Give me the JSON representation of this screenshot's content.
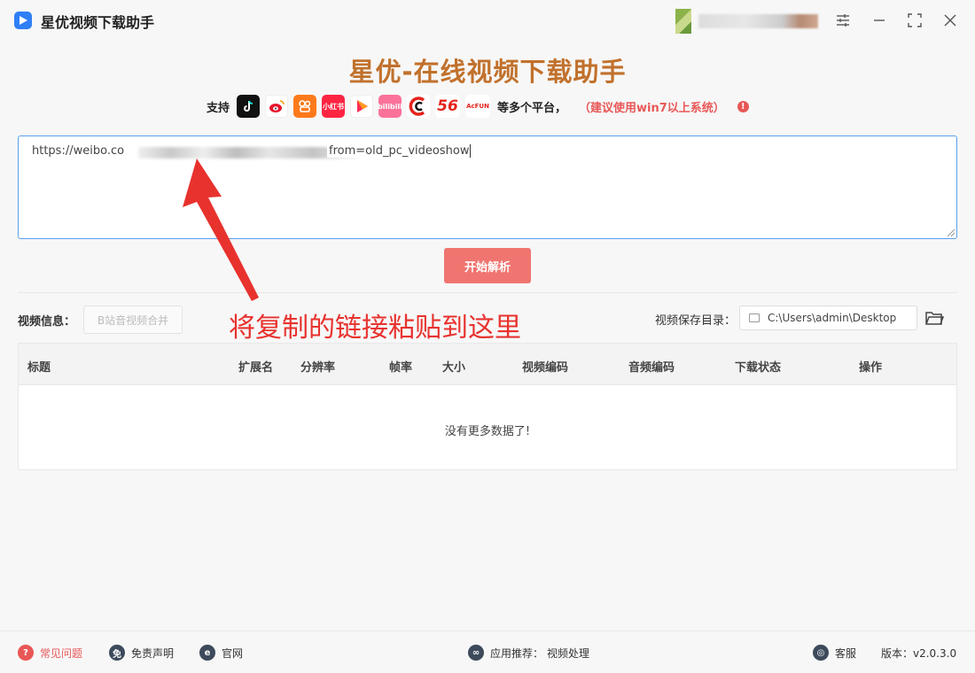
{
  "window": {
    "title": "星优视频下载助手"
  },
  "header": {
    "heading": "星优-在线视频下载助手",
    "support_label": "支持",
    "platforms": [
      {
        "name": "douyin",
        "icon": "douyin-icon",
        "label": ""
      },
      {
        "name": "weibo",
        "icon": "weibo-icon",
        "label": ""
      },
      {
        "name": "kuaishou",
        "icon": "kuaishou-icon",
        "label": ""
      },
      {
        "name": "xiaohongshu",
        "icon": "xiaohongshu-icon",
        "label": "小红书"
      },
      {
        "name": "xigua",
        "icon": "xigua-icon",
        "label": ""
      },
      {
        "name": "bilibili",
        "icon": "bilibili-icon",
        "label": "bilibili"
      },
      {
        "name": "cctv",
        "icon": "cctv-icon",
        "label": ""
      },
      {
        "name": "56",
        "icon": "56-icon",
        "label": "56"
      },
      {
        "name": "acfun",
        "icon": "acfun-icon",
        "label": "AcFUN"
      }
    ],
    "more_platforms": "等多个平台，",
    "warning": "（建议使用win7以上系统）"
  },
  "input": {
    "url_prefix": "https://weibo.co",
    "url_suffix": "from=old_pc_videoshow"
  },
  "parse_button": "开始解析",
  "video_info_label": "视频信息：",
  "merge_button": "B站音视频合并",
  "annotation": "将复制的链接粘贴到这里",
  "save": {
    "label": "视频保存目录：",
    "path": "C:\\Users\\admin\\Desktop"
  },
  "table": {
    "columns": [
      "标题",
      "扩展名",
      "分辨率",
      "帧率",
      "大小",
      "视频编码",
      "音频编码",
      "下载状态",
      "操作"
    ],
    "empty_message": "没有更多数据了!"
  },
  "footer": {
    "faq": "常见问题",
    "disclaimer": "免责声明",
    "website": "官网",
    "recommend_label": "应用推荐：",
    "recommend_value": "视频处理",
    "support": "客服",
    "version": "版本：v2.0.3.0"
  },
  "colors": {
    "accent_heading": "#c1712c",
    "primary_button": "#f07570",
    "warning_red": "#e95757",
    "annotation_red": "#e8322e",
    "input_border": "#5aa0ee"
  }
}
